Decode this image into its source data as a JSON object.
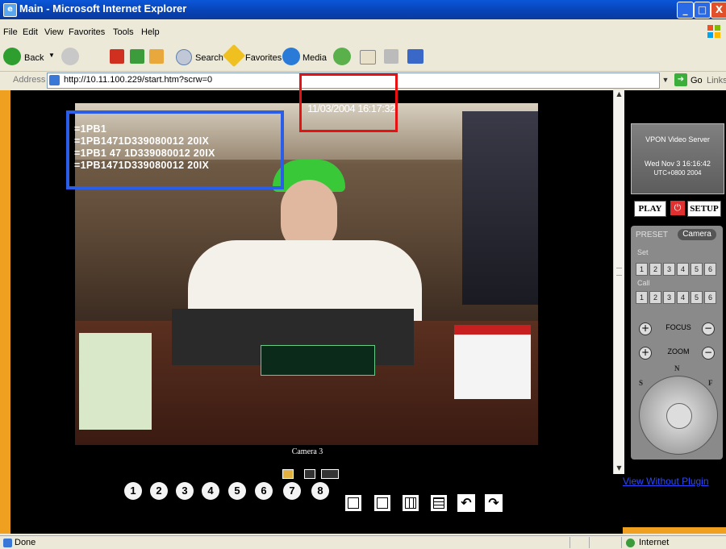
{
  "window": {
    "title": "Main - Microsoft Internet Explorer",
    "minimize_label": "_",
    "maximize_label": "□",
    "close_label": "X"
  },
  "menu": {
    "items": [
      "File",
      "Edit",
      "View",
      "Favorites",
      "Tools",
      "Help"
    ]
  },
  "toolbar": {
    "back_label": "Back",
    "search_label": "Search",
    "favorites_label": "Favorites",
    "media_label": "Media"
  },
  "address": {
    "label": "Address",
    "url": "http://10.11.100.229/start.htm?scrw=0",
    "go_label": "Go",
    "links_label": "Links"
  },
  "video": {
    "timestamp": "11/03/2004 16:17:32",
    "osd_lines": [
      "=1PB1",
      "=1PB1471D339080012 20IX",
      "=1PB1 47 1D339080012 20IX",
      "=1PB1471D339080012 20IX"
    ],
    "camera_label": "Camera 3"
  },
  "channels": [
    "1",
    "2",
    "3",
    "4",
    "5",
    "6",
    "7",
    "8"
  ],
  "server": {
    "name": "VPON Video Server",
    "time": "Wed Nov 3 16:16:42",
    "timezone": "UTC+0800 2004",
    "play_label": "PLAY",
    "setup_label": "SETUP"
  },
  "ptz": {
    "preset_label": "PRESET",
    "camera_tab": "Camera",
    "set_label": "Set",
    "call_label": "Call",
    "set_buttons": [
      "1",
      "2",
      "3",
      "4",
      "5",
      "6"
    ],
    "call_buttons": [
      "1",
      "2",
      "3",
      "4",
      "5",
      "6"
    ],
    "focus_label": "FOCUS",
    "zoom_label": "ZOOM",
    "plus": "+",
    "minus": "−",
    "dial_n": "N",
    "dial_s": "S",
    "dial_f": "F"
  },
  "view_without_plugin": "View Without Plugin",
  "status": {
    "text": "Done",
    "zone": "Internet"
  },
  "colors": {
    "titlebar": "#0842b4",
    "timestamp_highlight": "#e81010",
    "osd_highlight": "#2a5ee8",
    "accent_orange": "#f0a020"
  }
}
